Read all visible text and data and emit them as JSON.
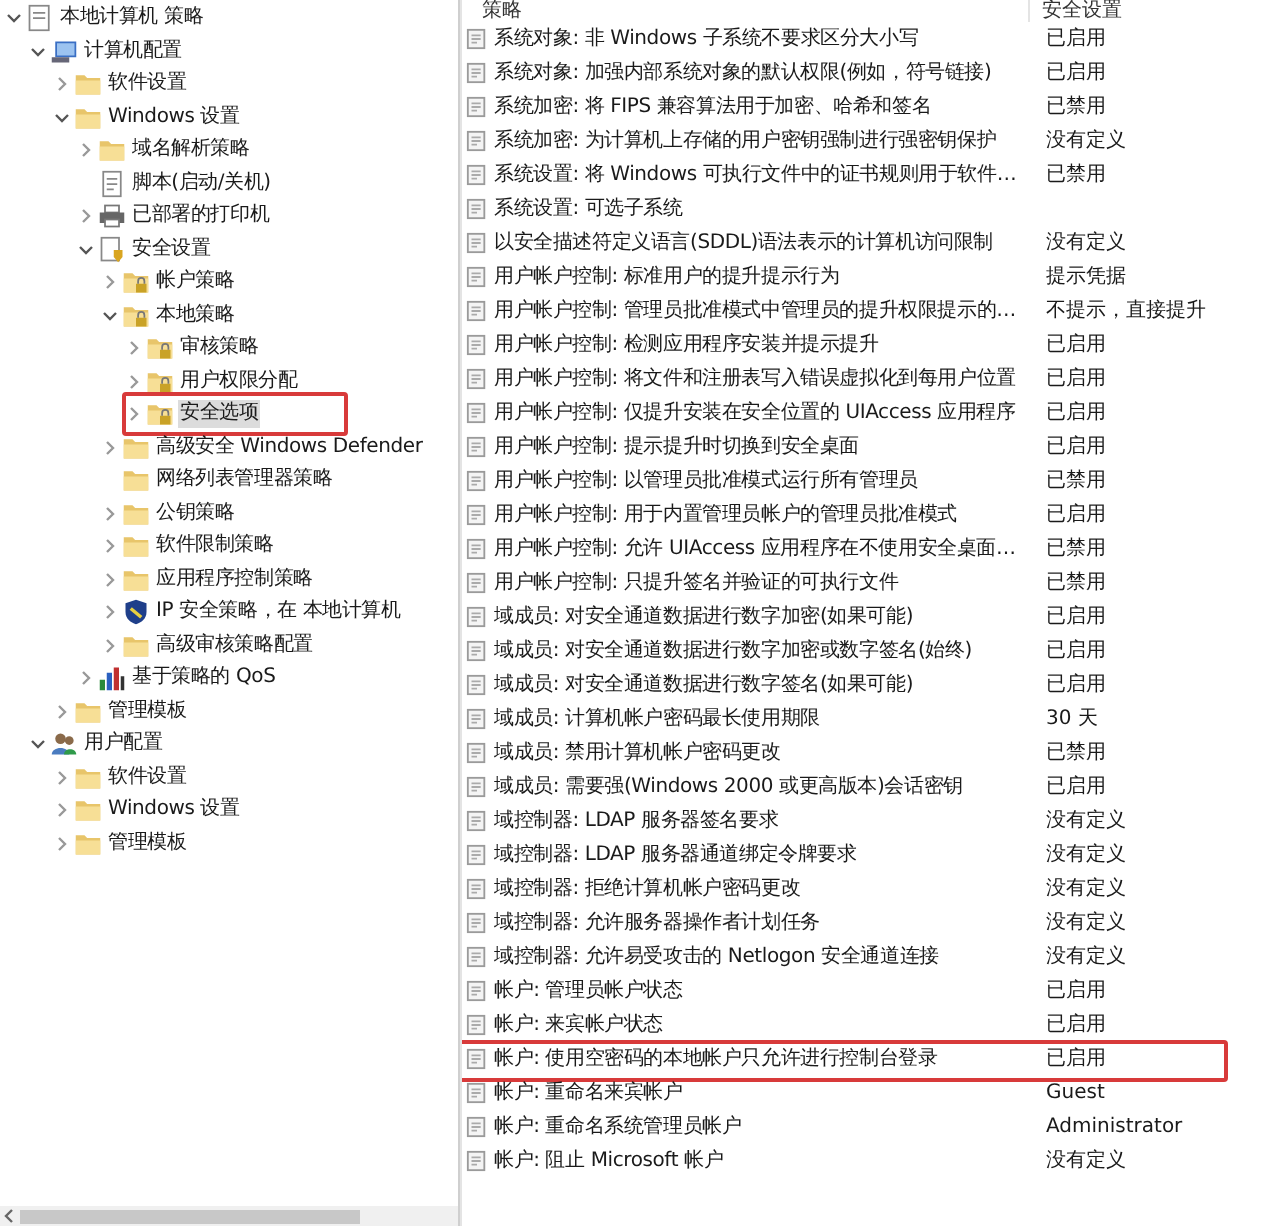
{
  "tree": [
    {
      "label": "本地计算机 策略",
      "kind": "document",
      "expanded": true,
      "selected": false,
      "highlighted": false,
      "children": [
        {
          "label": "计算机配置",
          "kind": "computer",
          "expanded": true,
          "selected": false,
          "highlighted": false,
          "children": [
            {
              "label": "软件设置",
              "kind": "folder",
              "expanded": false,
              "selected": false,
              "highlighted": false
            },
            {
              "label": "Windows 设置",
              "kind": "folder",
              "expanded": true,
              "selected": false,
              "highlighted": false,
              "children": [
                {
                  "label": "域名解析策略",
                  "kind": "folder",
                  "expanded": false,
                  "selected": false,
                  "highlighted": false
                },
                {
                  "label": "脚本(启动/关机)",
                  "kind": "script",
                  "selected": false,
                  "highlighted": false
                },
                {
                  "label": "已部署的打印机",
                  "kind": "printer",
                  "expanded": false,
                  "selected": false,
                  "highlighted": false
                },
                {
                  "label": "安全设置",
                  "kind": "security",
                  "expanded": true,
                  "selected": false,
                  "highlighted": false,
                  "children": [
                    {
                      "label": "帐户策略",
                      "kind": "lock-folder",
                      "expanded": false,
                      "selected": false,
                      "highlighted": false
                    },
                    {
                      "label": "本地策略",
                      "kind": "lock-folder",
                      "expanded": true,
                      "selected": false,
                      "highlighted": false,
                      "children": [
                        {
                          "label": "审核策略",
                          "kind": "lock-folder",
                          "expanded": false,
                          "selected": false,
                          "highlighted": false
                        },
                        {
                          "label": "用户权限分配",
                          "kind": "lock-folder",
                          "expanded": false,
                          "selected": false,
                          "highlighted": false
                        },
                        {
                          "label": "安全选项",
                          "kind": "lock-folder",
                          "expanded": false,
                          "selected": true,
                          "highlighted": true
                        }
                      ]
                    },
                    {
                      "label": "高级安全 Windows Defender",
                      "kind": "folder",
                      "expanded": false,
                      "selected": false,
                      "highlighted": false
                    },
                    {
                      "label": "网络列表管理器策略",
                      "kind": "folder",
                      "selected": false,
                      "highlighted": false
                    },
                    {
                      "label": "公钥策略",
                      "kind": "folder",
                      "expanded": false,
                      "selected": false,
                      "highlighted": false
                    },
                    {
                      "label": "软件限制策略",
                      "kind": "folder",
                      "expanded": false,
                      "selected": false,
                      "highlighted": false
                    },
                    {
                      "label": "应用程序控制策略",
                      "kind": "folder",
                      "expanded": false,
                      "selected": false,
                      "highlighted": false
                    },
                    {
                      "label": "IP 安全策略，在 本地计算机",
                      "kind": "ipsec",
                      "expanded": false,
                      "selected": false,
                      "highlighted": false
                    },
                    {
                      "label": "高级审核策略配置",
                      "kind": "folder",
                      "expanded": false,
                      "selected": false,
                      "highlighted": false
                    }
                  ]
                },
                {
                  "label": "基于策略的 QoS",
                  "kind": "qos",
                  "expanded": false,
                  "selected": false,
                  "highlighted": false
                }
              ]
            },
            {
              "label": "管理模板",
              "kind": "folder",
              "expanded": false,
              "selected": false,
              "highlighted": false
            }
          ]
        },
        {
          "label": "用户配置",
          "kind": "users",
          "expanded": true,
          "selected": false,
          "highlighted": false,
          "children": [
            {
              "label": "软件设置",
              "kind": "folder",
              "expanded": false,
              "selected": false,
              "highlighted": false
            },
            {
              "label": "Windows 设置",
              "kind": "folder",
              "expanded": false,
              "selected": false,
              "highlighted": false
            },
            {
              "label": "管理模板",
              "kind": "folder",
              "expanded": false,
              "selected": false,
              "highlighted": false
            }
          ]
        }
      ]
    }
  ],
  "table": {
    "columns": [
      "策略",
      "安全设置"
    ],
    "rows": [
      {
        "policy": "系统对象: 非 Windows 子系统不要求区分大小写",
        "setting": "已启用",
        "highlighted": false
      },
      {
        "policy": "系统对象: 加强内部系统对象的默认权限(例如，符号链接)",
        "setting": "已启用",
        "highlighted": false
      },
      {
        "policy": "系统加密: 将 FIPS 兼容算法用于加密、哈希和签名",
        "setting": "已禁用",
        "highlighted": false
      },
      {
        "policy": "系统加密: 为计算机上存储的用户密钥强制进行强密钥保护",
        "setting": "没有定义",
        "highlighted": false
      },
      {
        "policy": "系统设置: 将 Windows 可执行文件中的证书规则用于软件…",
        "setting": "已禁用",
        "highlighted": false
      },
      {
        "policy": "系统设置: 可选子系统",
        "highlighted": false
      },
      {
        "policy": "以安全描述符定义语言(SDDL)语法表示的计算机访问限制",
        "setting": "没有定义",
        "highlighted": false
      },
      {
        "policy": "用户帐户控制: 标准用户的提升提示行为",
        "setting": "提示凭据",
        "highlighted": false
      },
      {
        "policy": "用户帐户控制: 管理员批准模式中管理员的提升权限提示的…",
        "setting": "不提示，直接提升",
        "highlighted": false
      },
      {
        "policy": "用户帐户控制: 检测应用程序安装并提示提升",
        "setting": "已启用",
        "highlighted": false
      },
      {
        "policy": "用户帐户控制: 将文件和注册表写入错误虚拟化到每用户位置",
        "setting": "已启用",
        "highlighted": false
      },
      {
        "policy": "用户帐户控制: 仅提升安装在安全位置的 UIAccess 应用程序",
        "setting": "已启用",
        "highlighted": false
      },
      {
        "policy": "用户帐户控制: 提示提升时切换到安全桌面",
        "setting": "已启用",
        "highlighted": false
      },
      {
        "policy": "用户帐户控制: 以管理员批准模式运行所有管理员",
        "setting": "已禁用",
        "highlighted": false
      },
      {
        "policy": "用户帐户控制: 用于内置管理员帐户的管理员批准模式",
        "setting": "已启用",
        "highlighted": false
      },
      {
        "policy": "用户帐户控制: 允许 UIAccess 应用程序在不使用安全桌面…",
        "setting": "已禁用",
        "highlighted": false
      },
      {
        "policy": "用户帐户控制: 只提升签名并验证的可执行文件",
        "setting": "已禁用",
        "highlighted": false
      },
      {
        "policy": "域成员: 对安全通道数据进行数字加密(如果可能)",
        "setting": "已启用",
        "highlighted": false
      },
      {
        "policy": "域成员: 对安全通道数据进行数字加密或数字签名(始终)",
        "setting": "已启用",
        "highlighted": false
      },
      {
        "policy": "域成员: 对安全通道数据进行数字签名(如果可能)",
        "setting": "已启用",
        "highlighted": false
      },
      {
        "policy": "域成员: 计算机帐户密码最长使用期限",
        "setting": "30 天",
        "highlighted": false
      },
      {
        "policy": "域成员: 禁用计算机帐户密码更改",
        "setting": "已禁用",
        "highlighted": false
      },
      {
        "policy": "域成员: 需要强(Windows 2000 或更高版本)会话密钥",
        "setting": "已启用",
        "highlighted": false
      },
      {
        "policy": "域控制器: LDAP 服务器签名要求",
        "setting": "没有定义",
        "highlighted": false
      },
      {
        "policy": "域控制器: LDAP 服务器通道绑定令牌要求",
        "setting": "没有定义",
        "highlighted": false
      },
      {
        "policy": "域控制器: 拒绝计算机帐户密码更改",
        "setting": "没有定义",
        "highlighted": false
      },
      {
        "policy": "域控制器: 允许服务器操作者计划任务",
        "setting": "没有定义",
        "highlighted": false
      },
      {
        "policy": "域控制器: 允许易受攻击的 Netlogon 安全通道连接",
        "setting": "没有定义",
        "highlighted": false
      },
      {
        "policy": "帐户: 管理员帐户状态",
        "setting": "已启用",
        "highlighted": false
      },
      {
        "policy": "帐户: 来宾帐户状态",
        "setting": "已启用",
        "highlighted": false
      },
      {
        "policy": "帐户: 使用空密码的本地帐户只允许进行控制台登录",
        "setting": "已启用",
        "highlighted": true
      },
      {
        "policy": "帐户: 重命名来宾帐户",
        "setting": "Guest",
        "highlighted": false
      },
      {
        "policy": "帐户: 重命名系统管理员帐户",
        "setting": "Administrator",
        "highlighted": false
      },
      {
        "policy": "帐户: 阻止 Microsoft 帐户",
        "setting": "没有定义",
        "highlighted": false
      }
    ]
  }
}
